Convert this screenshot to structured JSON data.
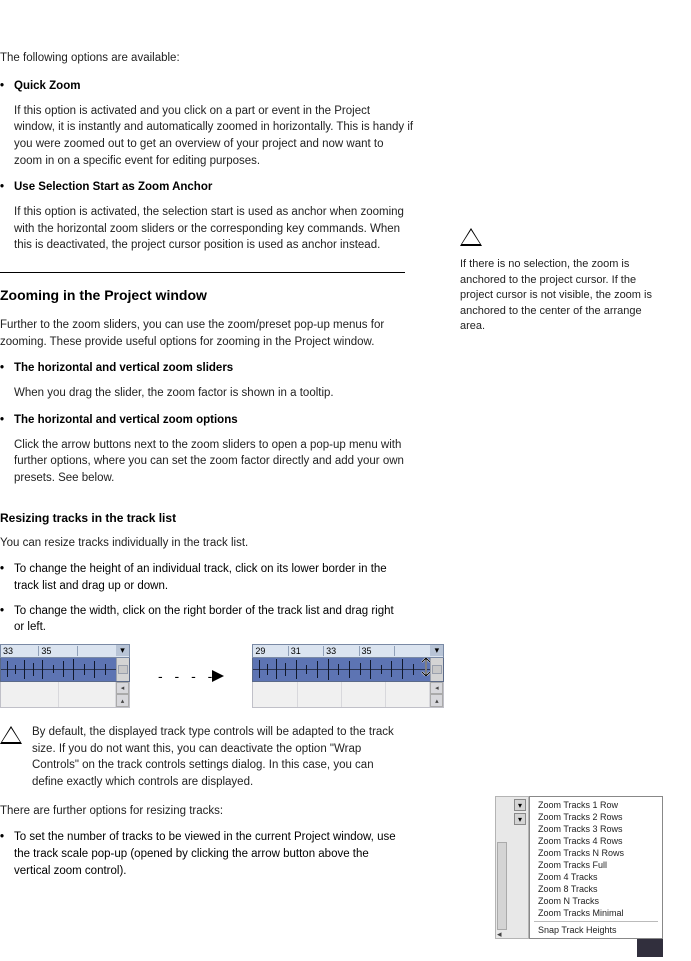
{
  "intro": "The following options are available:",
  "bullets_top": [
    {
      "title": "Quick Zoom",
      "desc": "If this option is activated and you click on a part or event in the Project window, it is instantly and automatically zoomed in horizontally. This is handy if you were zoomed out to get an overview of your project and now want to zoom in on a specific event for editing purposes."
    },
    {
      "title": "Use Selection Start as Zoom Anchor",
      "desc": "If this option is activated, the selection start is used as anchor when zooming with the horizontal zoom sliders or the corresponding key commands. When this is deactivated, the project cursor position is used as anchor instead."
    }
  ],
  "note_inline": "If there is no selection, the zoom is anchored to the project cursor. If the project cursor is not visible, the zoom is anchored to the center of the arrange area.",
  "subhead": "Resizing tracks in the track list",
  "h2": "Zooming in the Project window",
  "para_preset_intro": "Further to the zoom sliders, you can use the zoom/preset pop-up menus for zooming. These provide useful options for zooming in the Project window.",
  "bullets_mid": [
    {
      "title": "The horizontal and vertical zoom sliders",
      "desc": "When you drag the slider, the zoom factor is shown in a tooltip."
    },
    {
      "title": "The horizontal and vertical zoom options",
      "desc": "Click the arrow buttons next to the zoom sliders to open a pop-up menu with further options, where you can set the zoom factor directly and add your own presets. See below."
    }
  ],
  "para_resize": "You can resize tracks individually in the track list.",
  "bullets_resize": [
    {
      "text": "To change the height of an individual track, click on its lower border in the track list and drag up or down."
    },
    {
      "text": "To change the width, click on the right border of the track list and drag right or left."
    }
  ],
  "note_block": "By default, the displayed track type controls will be adapted to the track size. If you do not want this, you can deactivate the option \"Wrap Controls\" on the track controls settings dialog. In this case, you can define exactly which controls are displayed.",
  "para_last": "There are further options for resizing tracks:",
  "bullet_last": "To set the number of tracks to be viewed in the current Project window, use the track scale pop-up (opened by clicking the arrow button above the vertical zoom control).",
  "fig_a": {
    "ticks": [
      "33",
      "35"
    ]
  },
  "fig_b": {
    "ticks": [
      "29",
      "31",
      "33",
      "35"
    ]
  },
  "menu": {
    "items": [
      "Zoom Tracks 1 Row",
      "Zoom Tracks 2 Rows",
      "Zoom Tracks 3 Rows",
      "Zoom Tracks 4 Rows",
      "Zoom Tracks N Rows",
      "Zoom Tracks Full",
      "Zoom 4 Tracks",
      "Zoom 8 Tracks",
      "Zoom N Tracks",
      "Zoom Tracks Minimal"
    ],
    "last": "Snap Track Heights"
  }
}
